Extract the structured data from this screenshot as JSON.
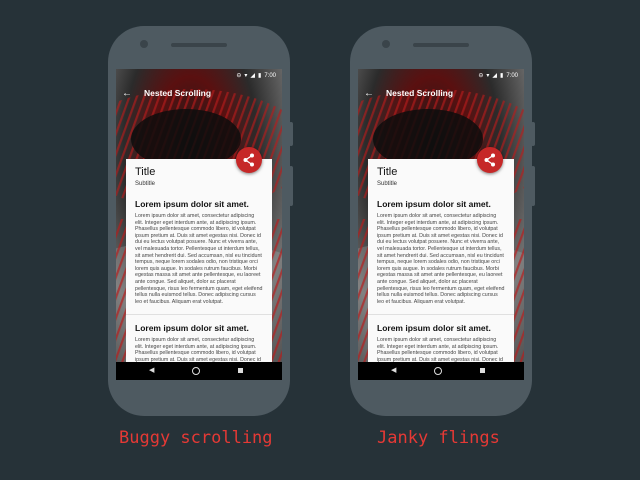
{
  "colors": {
    "background": "#263238",
    "fab": "#c62828",
    "caption": "#e53935"
  },
  "status_bar": {
    "time": "7:00",
    "icons": [
      "do-not-disturb-icon",
      "wifi-icon",
      "signal-icon",
      "battery-icon"
    ]
  },
  "toolbar": {
    "title": "Nested Scrolling",
    "back_icon": "arrow-back-icon"
  },
  "fab": {
    "icon": "share-icon"
  },
  "card": {
    "title": "Title",
    "subtitle": "Subtitle",
    "sections": [
      {
        "heading": "Lorem ipsum dolor sit amet.",
        "body": "Lorem ipsum dolor sit amet, consectetur adipiscing elit. Integer eget interdum ante, at adipiscing ipsum. Phasellus pellentesque commodo libero, id volutpat ipsum pretium at. Duis sit amet egestas nisi. Donec id dui eu lectus volutpat posuere. Nunc et viverra ante, vel malesuada tortor. Pellentesque ut interdum tellus, sit amet hendrerit dui. Sed accumsan, nisl eu tincidunt tempus, neque lorem sodales odio, non tristique orci lorem quis augue. In sodales rutrum faucibus. Morbi egestas massa sit amet ante pellentesque, eu laoreet ante congue. Sed aliquet, dolor ac placerat pellentesque, risus leo fermentum quam, eget eleifend tellus nulla euismod tellus. Donec adipiscing cursus leo et faucibus. Aliquam erat volutpat."
      },
      {
        "heading": "Lorem ipsum dolor sit amet.",
        "body": "Lorem ipsum dolor sit amet, consectetur adipiscing elit. Integer eget interdum ante, at adipiscing ipsum. Phasellus pellentesque commodo libero, id volutpat ipsum pretium at. Duis sit amet egestas nisi. Donec id dui eu lectus volutpat posuere. Nunc et viverra ante, vel malesuada tortor. Pellentesque ut interdum tellus, sit amet hendrerit dui."
      }
    ]
  },
  "navbar": {
    "icons": [
      "nav-back-icon",
      "nav-home-icon",
      "nav-recents-icon"
    ]
  },
  "captions": {
    "left": "Buggy scrolling",
    "right": "Janky flings"
  }
}
